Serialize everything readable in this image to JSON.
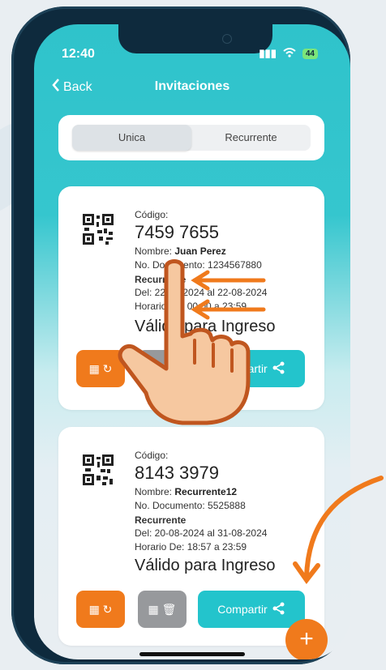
{
  "status": {
    "time": "12:40",
    "signal": "ıll",
    "wifi": "wifi",
    "battery": "44"
  },
  "nav": {
    "back_label": "Back",
    "title": "Invitaciones"
  },
  "segments": {
    "single": "Unica",
    "recurring": "Recurrente",
    "selected": "Unica"
  },
  "cards": [
    {
      "code_label": "Código:",
      "code": "7459 7655",
      "name_label": "Nombre:",
      "name": "Juan Perez",
      "doc": "No. Documento: 1234567880",
      "type": "Recurrente",
      "dates": "Del: 22-08-2024 al 22-08-2024",
      "hours": "Horario De: 00:00 a 23:59",
      "validity": "Válido para Ingreso",
      "share_label": "Compartir"
    },
    {
      "code_label": "Código:",
      "code": "8143 3979",
      "name_label": "Nombre:",
      "name": "Recurrente12",
      "doc": "No. Documento: 5525888",
      "type": "Recurrente",
      "dates": "Del: 20-08-2024 al 31-08-2024",
      "hours": "Horario De: 18:57 a 23:59",
      "validity": "Válido para Ingreso",
      "share_label": "Compartir"
    }
  ],
  "fab_label": "+",
  "colors": {
    "accent": "#23c4cc",
    "orange": "#f07a1c",
    "gray": "#97999c"
  }
}
